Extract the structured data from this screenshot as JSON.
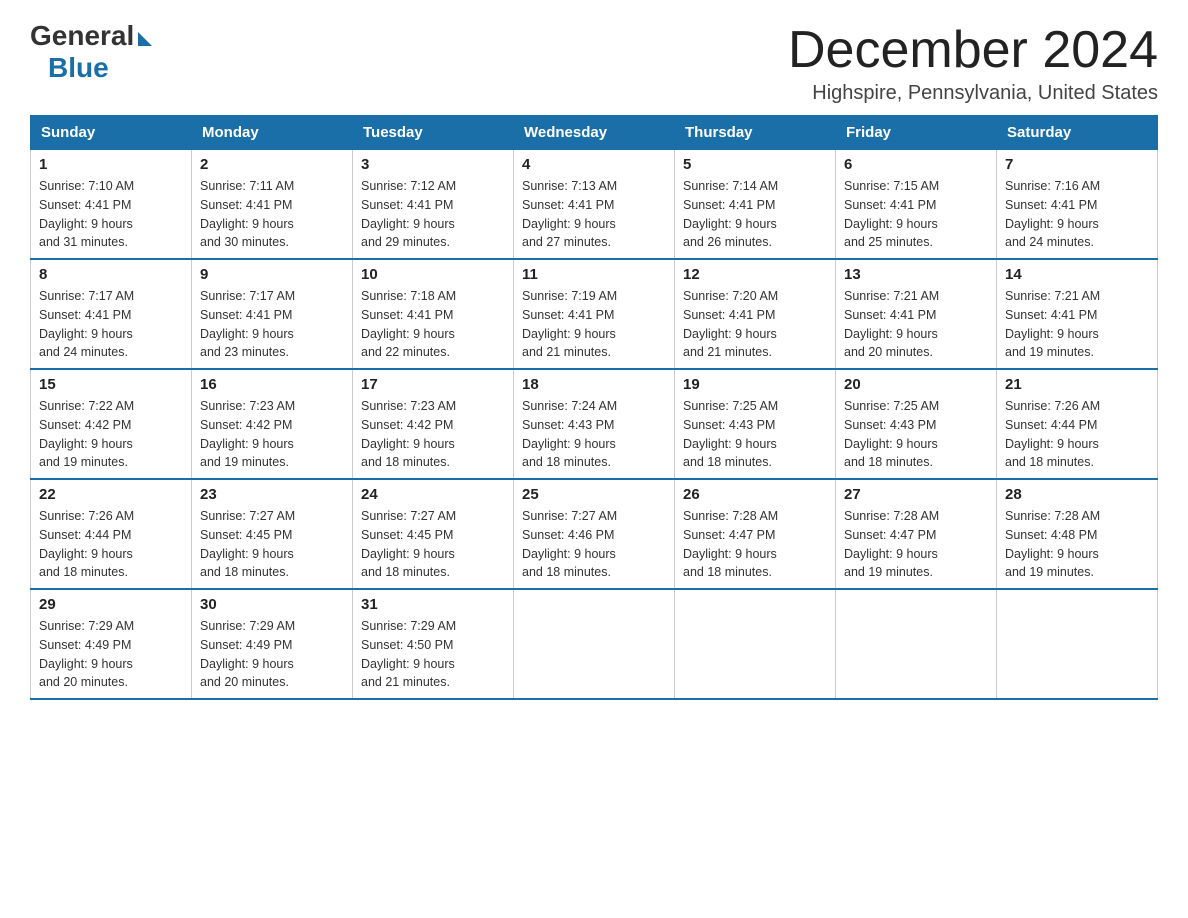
{
  "logo": {
    "general_text": "General",
    "blue_text": "Blue"
  },
  "title": "December 2024",
  "location": "Highspire, Pennsylvania, United States",
  "days_of_week": [
    "Sunday",
    "Monday",
    "Tuesday",
    "Wednesday",
    "Thursday",
    "Friday",
    "Saturday"
  ],
  "weeks": [
    [
      {
        "day": "1",
        "sunrise": "7:10 AM",
        "sunset": "4:41 PM",
        "daylight": "9 hours and 31 minutes."
      },
      {
        "day": "2",
        "sunrise": "7:11 AM",
        "sunset": "4:41 PM",
        "daylight": "9 hours and 30 minutes."
      },
      {
        "day": "3",
        "sunrise": "7:12 AM",
        "sunset": "4:41 PM",
        "daylight": "9 hours and 29 minutes."
      },
      {
        "day": "4",
        "sunrise": "7:13 AM",
        "sunset": "4:41 PM",
        "daylight": "9 hours and 27 minutes."
      },
      {
        "day": "5",
        "sunrise": "7:14 AM",
        "sunset": "4:41 PM",
        "daylight": "9 hours and 26 minutes."
      },
      {
        "day": "6",
        "sunrise": "7:15 AM",
        "sunset": "4:41 PM",
        "daylight": "9 hours and 25 minutes."
      },
      {
        "day": "7",
        "sunrise": "7:16 AM",
        "sunset": "4:41 PM",
        "daylight": "9 hours and 24 minutes."
      }
    ],
    [
      {
        "day": "8",
        "sunrise": "7:17 AM",
        "sunset": "4:41 PM",
        "daylight": "9 hours and 24 minutes."
      },
      {
        "day": "9",
        "sunrise": "7:17 AM",
        "sunset": "4:41 PM",
        "daylight": "9 hours and 23 minutes."
      },
      {
        "day": "10",
        "sunrise": "7:18 AM",
        "sunset": "4:41 PM",
        "daylight": "9 hours and 22 minutes."
      },
      {
        "day": "11",
        "sunrise": "7:19 AM",
        "sunset": "4:41 PM",
        "daylight": "9 hours and 21 minutes."
      },
      {
        "day": "12",
        "sunrise": "7:20 AM",
        "sunset": "4:41 PM",
        "daylight": "9 hours and 21 minutes."
      },
      {
        "day": "13",
        "sunrise": "7:21 AM",
        "sunset": "4:41 PM",
        "daylight": "9 hours and 20 minutes."
      },
      {
        "day": "14",
        "sunrise": "7:21 AM",
        "sunset": "4:41 PM",
        "daylight": "9 hours and 19 minutes."
      }
    ],
    [
      {
        "day": "15",
        "sunrise": "7:22 AM",
        "sunset": "4:42 PM",
        "daylight": "9 hours and 19 minutes."
      },
      {
        "day": "16",
        "sunrise": "7:23 AM",
        "sunset": "4:42 PM",
        "daylight": "9 hours and 19 minutes."
      },
      {
        "day": "17",
        "sunrise": "7:23 AM",
        "sunset": "4:42 PM",
        "daylight": "9 hours and 18 minutes."
      },
      {
        "day": "18",
        "sunrise": "7:24 AM",
        "sunset": "4:43 PM",
        "daylight": "9 hours and 18 minutes."
      },
      {
        "day": "19",
        "sunrise": "7:25 AM",
        "sunset": "4:43 PM",
        "daylight": "9 hours and 18 minutes."
      },
      {
        "day": "20",
        "sunrise": "7:25 AM",
        "sunset": "4:43 PM",
        "daylight": "9 hours and 18 minutes."
      },
      {
        "day": "21",
        "sunrise": "7:26 AM",
        "sunset": "4:44 PM",
        "daylight": "9 hours and 18 minutes."
      }
    ],
    [
      {
        "day": "22",
        "sunrise": "7:26 AM",
        "sunset": "4:44 PM",
        "daylight": "9 hours and 18 minutes."
      },
      {
        "day": "23",
        "sunrise": "7:27 AM",
        "sunset": "4:45 PM",
        "daylight": "9 hours and 18 minutes."
      },
      {
        "day": "24",
        "sunrise": "7:27 AM",
        "sunset": "4:45 PM",
        "daylight": "9 hours and 18 minutes."
      },
      {
        "day": "25",
        "sunrise": "7:27 AM",
        "sunset": "4:46 PM",
        "daylight": "9 hours and 18 minutes."
      },
      {
        "day": "26",
        "sunrise": "7:28 AM",
        "sunset": "4:47 PM",
        "daylight": "9 hours and 18 minutes."
      },
      {
        "day": "27",
        "sunrise": "7:28 AM",
        "sunset": "4:47 PM",
        "daylight": "9 hours and 19 minutes."
      },
      {
        "day": "28",
        "sunrise": "7:28 AM",
        "sunset": "4:48 PM",
        "daylight": "9 hours and 19 minutes."
      }
    ],
    [
      {
        "day": "29",
        "sunrise": "7:29 AM",
        "sunset": "4:49 PM",
        "daylight": "9 hours and 20 minutes."
      },
      {
        "day": "30",
        "sunrise": "7:29 AM",
        "sunset": "4:49 PM",
        "daylight": "9 hours and 20 minutes."
      },
      {
        "day": "31",
        "sunrise": "7:29 AM",
        "sunset": "4:50 PM",
        "daylight": "9 hours and 21 minutes."
      },
      null,
      null,
      null,
      null
    ]
  ],
  "labels": {
    "sunrise": "Sunrise:",
    "sunset": "Sunset:",
    "daylight": "Daylight:"
  }
}
